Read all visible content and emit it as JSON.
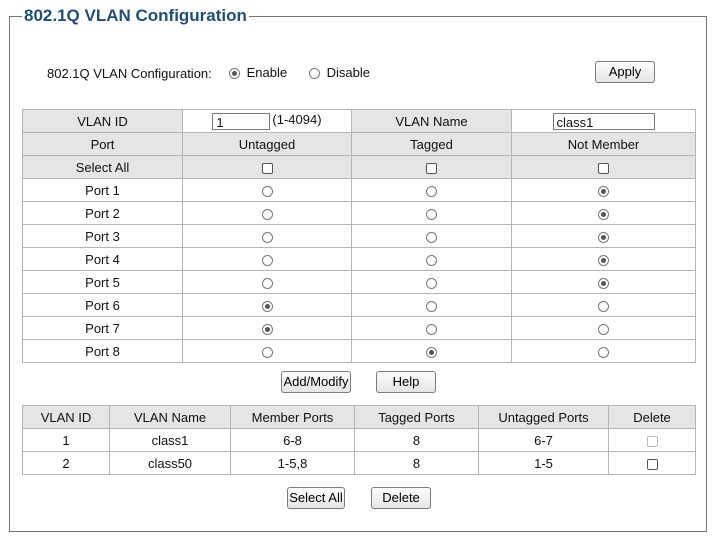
{
  "title": "802.1Q VLAN Configuration",
  "global": {
    "label": "802.1Q VLAN Configuration:",
    "enable_label": "Enable",
    "disable_label": "Disable",
    "selected": "Enable",
    "apply_label": "Apply"
  },
  "config": {
    "vlan_id_label": "VLAN ID",
    "vlan_id_value": "1",
    "vlan_id_range": "(1-4094)",
    "vlan_name_label": "VLAN Name",
    "vlan_name_value": "class1",
    "headers": [
      "Port",
      "Untagged",
      "Tagged",
      "Not Member"
    ],
    "select_all_label": "Select All",
    "ports": [
      {
        "name": "Port 1",
        "membership": "Not Member"
      },
      {
        "name": "Port 2",
        "membership": "Not Member"
      },
      {
        "name": "Port 3",
        "membership": "Not Member"
      },
      {
        "name": "Port 4",
        "membership": "Not Member"
      },
      {
        "name": "Port 5",
        "membership": "Not Member"
      },
      {
        "name": "Port 6",
        "membership": "Untagged"
      },
      {
        "name": "Port 7",
        "membership": "Untagged"
      },
      {
        "name": "Port 8",
        "membership": "Tagged"
      }
    ]
  },
  "actions": {
    "add_modify_label": "Add/Modify",
    "help_label": "Help"
  },
  "vlan_table": {
    "headers": [
      "VLAN ID",
      "VLAN Name",
      "Member Ports",
      "Tagged Ports",
      "Untagged Ports",
      "Delete"
    ],
    "rows": [
      {
        "id": "1",
        "name": "class1",
        "member": "6-8",
        "tagged": "8",
        "untagged": "6-7",
        "delete_disabled": true
      },
      {
        "id": "2",
        "name": "class50",
        "member": "1-5,8",
        "tagged": "8",
        "untagged": "1-5",
        "delete_disabled": false
      }
    ]
  },
  "bottom": {
    "select_all_label": "Select All",
    "delete_label": "Delete"
  }
}
